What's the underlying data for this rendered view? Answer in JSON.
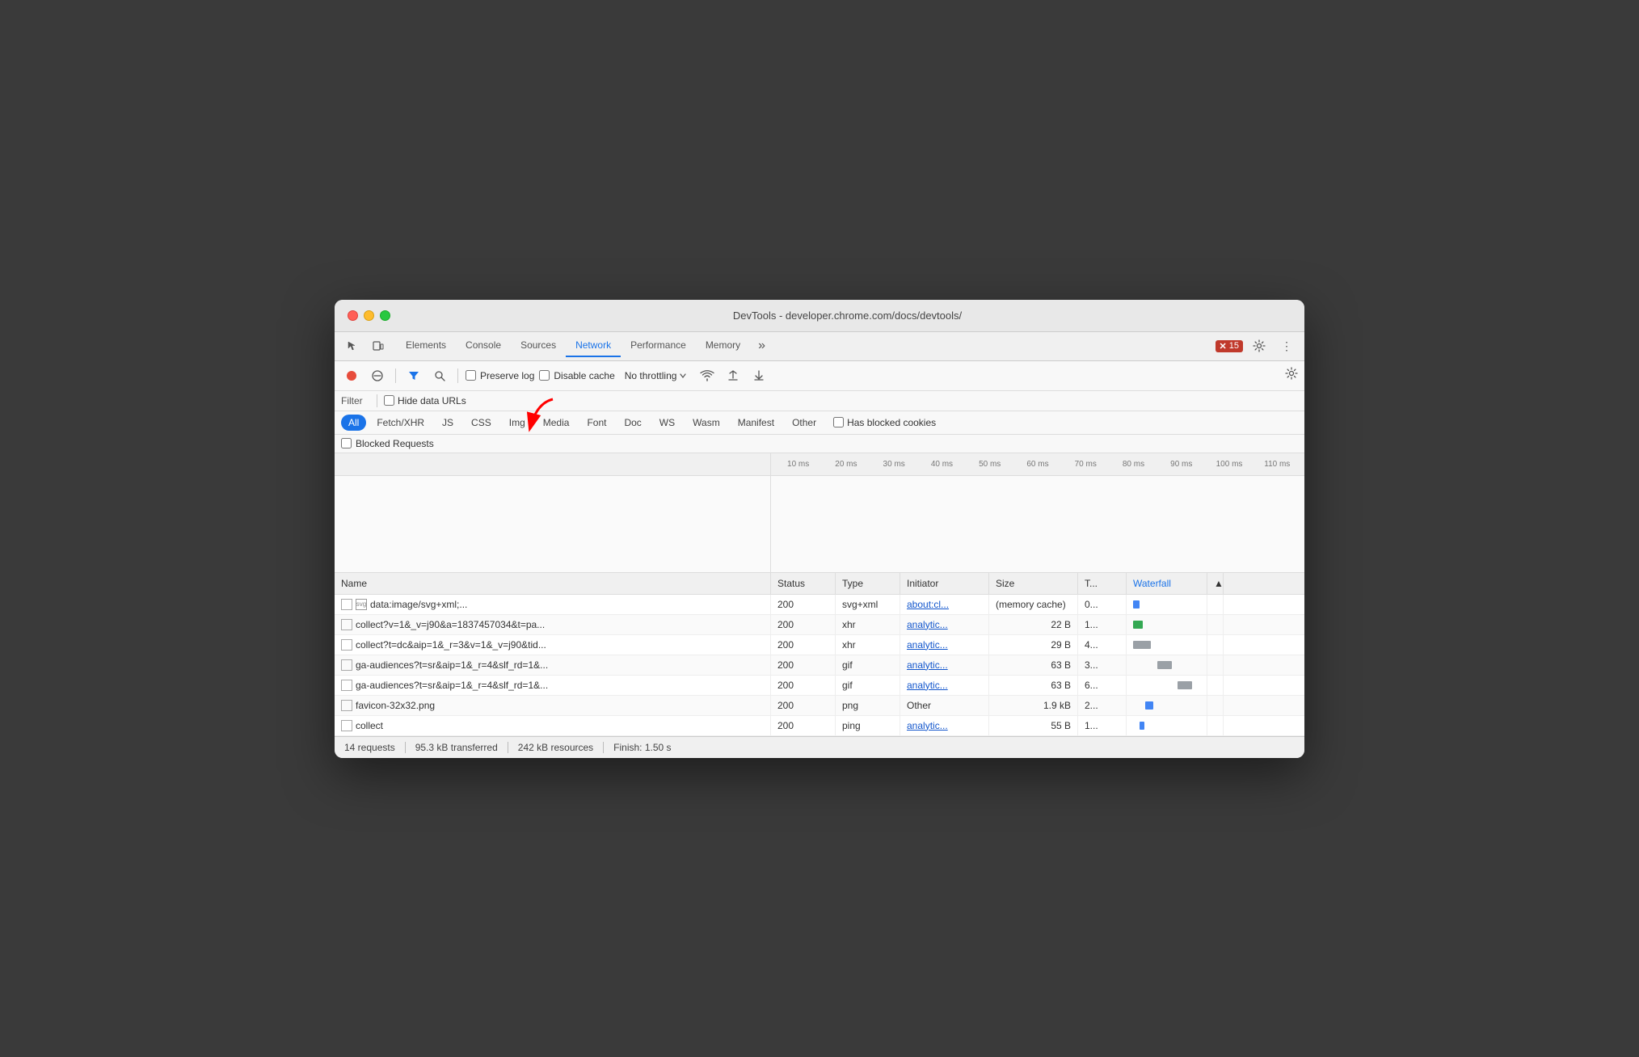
{
  "window": {
    "title": "DevTools - developer.chrome.com/docs/devtools/"
  },
  "tabs": {
    "items": [
      {
        "label": "Elements",
        "active": false
      },
      {
        "label": "Console",
        "active": false
      },
      {
        "label": "Sources",
        "active": false
      },
      {
        "label": "Network",
        "active": true
      },
      {
        "label": "Performance",
        "active": false
      },
      {
        "label": "Memory",
        "active": false
      }
    ],
    "more_label": "»",
    "error_count": "15"
  },
  "toolbar": {
    "record_title": "Record network log",
    "block_title": "Block request URL",
    "filter_title": "Filter",
    "search_title": "Search",
    "preserve_log_label": "Preserve log",
    "disable_cache_label": "Disable cache",
    "throttle_label": "No throttling",
    "settings_title": "Network settings"
  },
  "filter_bar": {
    "filter_label": "Filter",
    "hide_data_urls_label": "Hide data URLs"
  },
  "type_filters": [
    {
      "label": "All",
      "active": true
    },
    {
      "label": "Fetch/XHR",
      "active": false
    },
    {
      "label": "JS",
      "active": false
    },
    {
      "label": "CSS",
      "active": false
    },
    {
      "label": "Img",
      "active": false
    },
    {
      "label": "Media",
      "active": false
    },
    {
      "label": "Font",
      "active": false
    },
    {
      "label": "Doc",
      "active": false
    },
    {
      "label": "WS",
      "active": false
    },
    {
      "label": "Wasm",
      "active": false
    },
    {
      "label": "Manifest",
      "active": false
    },
    {
      "label": "Other",
      "active": false
    },
    {
      "label": "Has blocked cookies",
      "active": false
    }
  ],
  "blocked_requests": {
    "label": "Blocked Requests"
  },
  "timeline_ticks": [
    "10 ms",
    "20 ms",
    "30 ms",
    "40 ms",
    "50 ms",
    "60 ms",
    "70 ms",
    "80 ms",
    "90 ms",
    "100 ms",
    "110 ms"
  ],
  "table": {
    "headers": [
      {
        "label": "Name"
      },
      {
        "label": "Status"
      },
      {
        "label": "Type"
      },
      {
        "label": "Initiator"
      },
      {
        "label": "Size"
      },
      {
        "label": "T..."
      },
      {
        "label": "Waterfall",
        "sort": true
      },
      {
        "label": "▲"
      }
    ],
    "rows": [
      {
        "name": "data:image/svg+xml;...",
        "has_icon": true,
        "status": "200",
        "type": "svg+xml",
        "initiator": "about:cl...",
        "initiator_link": true,
        "size": "(memory cache)",
        "time": "0...",
        "waterfall_type": "blue"
      },
      {
        "name": "collect?v=1&_v=j90&a=1837457034&t=pa...",
        "has_icon": false,
        "status": "200",
        "type": "xhr",
        "initiator": "analytic...",
        "initiator_link": true,
        "size": "22 B",
        "time": "1...",
        "waterfall_type": "green"
      },
      {
        "name": "collect?t=dc&aip=1&_r=3&v=1&_v=j90&tid...",
        "has_icon": false,
        "status": "200",
        "type": "xhr",
        "initiator": "analytic...",
        "initiator_link": true,
        "size": "29 B",
        "time": "4...",
        "waterfall_type": "gray"
      },
      {
        "name": "ga-audiences?t=sr&aip=1&_r=4&slf_rd=1&...",
        "has_icon": false,
        "status": "200",
        "type": "gif",
        "initiator": "analytic...",
        "initiator_link": true,
        "size": "63 B",
        "time": "3...",
        "waterfall_type": "gray"
      },
      {
        "name": "ga-audiences?t=sr&aip=1&_r=4&slf_rd=1&...",
        "has_icon": false,
        "status": "200",
        "type": "gif",
        "initiator": "analytic...",
        "initiator_link": true,
        "size": "63 B",
        "time": "6...",
        "waterfall_type": "gray"
      },
      {
        "name": "favicon-32x32.png",
        "has_icon": false,
        "status": "200",
        "type": "png",
        "initiator": "Other",
        "initiator_link": false,
        "size": "1.9 kB",
        "time": "2...",
        "waterfall_type": "blue"
      },
      {
        "name": "collect",
        "has_icon": false,
        "status": "200",
        "type": "ping",
        "initiator": "analytic...",
        "initiator_link": true,
        "size": "55 B",
        "time": "1...",
        "waterfall_type": "blue"
      }
    ]
  },
  "status_bar": {
    "requests": "14 requests",
    "transferred": "95.3 kB transferred",
    "resources": "242 kB resources",
    "finish": "Finish: 1.50 s"
  }
}
